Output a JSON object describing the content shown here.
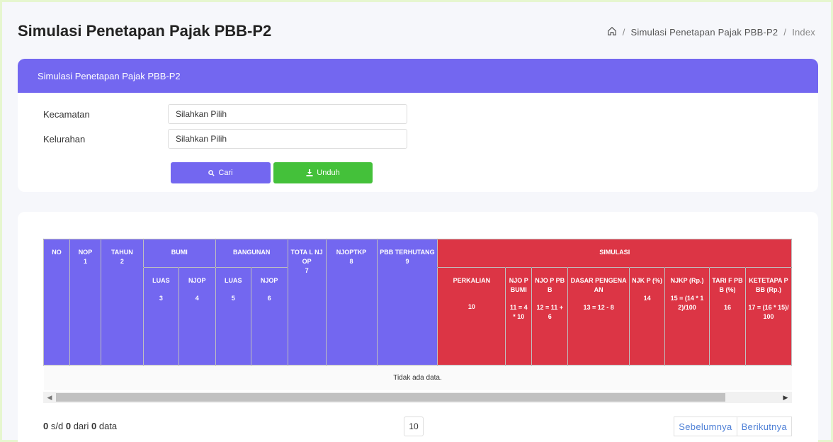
{
  "page": {
    "title": "Simulasi Penetapan Pajak PBB-P2"
  },
  "breadcrumb": {
    "item1": "Simulasi Penetapan Pajak PBB-P2",
    "current": "Index"
  },
  "filter_card": {
    "header": "Simulasi Penetapan Pajak PBB-P2",
    "kecamatan_label": "Kecamatan",
    "kecamatan_value": "Silahkan Pilih",
    "kelurahan_label": "Kelurahan",
    "kelurahan_value": "Silahkan Pilih",
    "cari_label": "Cari",
    "unduh_label": "Unduh"
  },
  "table": {
    "h_no": "NO",
    "h_nop": "NOP",
    "h_nop_n": "1",
    "h_tahun": "TAHUN",
    "h_tahun_n": "2",
    "h_bumi": "BUMI",
    "h_bangunan": "BANGUNAN",
    "h_total": "TOTA L NJOP",
    "h_total_n": "7",
    "h_njoptkp": "NJOPTKP",
    "h_njoptkp_n": "8",
    "h_pbb": "PBB TERHUTANG",
    "h_pbb_n": "9",
    "h_simulasi": "SIMULASI",
    "b_luas": "LUAS",
    "b_luas_n": "3",
    "b_njop": "NJOP",
    "b_njop_n": "4",
    "g_luas": "LUAS",
    "g_luas_n": "5",
    "g_njop": "NJOP",
    "g_njop_n": "6",
    "s_perkalian": "PERKALIAN",
    "s_perkalian_n": "10",
    "s_njop_bumi": "NJO P BUMI",
    "s_njop_bumi_f": "11 = 4 * 10",
    "s_njop_pbb": "NJO P PBB",
    "s_njop_pbb_f": "12 = 11 + 6",
    "s_dasar": "DASAR PENGENAAN",
    "s_dasar_f": "13 = 12 - 8",
    "s_njkp_pct": "NJK P (%)",
    "s_njkp_pct_n": "14",
    "s_njkp_rp": "NJKP (Rp.)",
    "s_njkp_rp_f": "15 = (14 * 12)/100",
    "s_tarif": "TARI F PBB (%)",
    "s_tarif_n": "16",
    "s_ketetapan": "KETETAPA PBB (Rp.)",
    "s_ketetapan_f": "17 = (16 * 15)/100",
    "empty_text": "Tidak ada data."
  },
  "footer": {
    "from": "0",
    "sd": "s/d",
    "to": "0",
    "dari": "dari",
    "total": "0",
    "data": "data",
    "perpage": "10",
    "prev": "Sebelumnya",
    "next": "Berikutnya"
  },
  "colors": {
    "primary": "#7367f0",
    "danger": "#dc3545",
    "success": "#44c13a"
  },
  "icons": {
    "home": "home-icon",
    "search": "search-icon",
    "download": "download-icon"
  }
}
